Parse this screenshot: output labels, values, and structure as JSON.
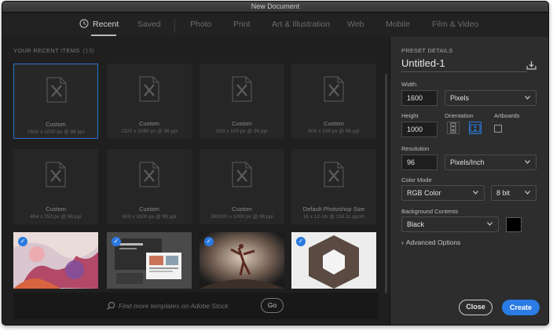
{
  "window": {
    "title": "New Document"
  },
  "tabs": [
    {
      "label": "Recent",
      "active": true
    },
    {
      "label": "Saved"
    },
    {
      "label": "Photo"
    },
    {
      "label": "Print"
    },
    {
      "label": "Art & Illustration"
    },
    {
      "label": "Web"
    },
    {
      "label": "Mobile"
    },
    {
      "label": "Film & Video"
    }
  ],
  "recent": {
    "heading": "YOUR RECENT ITEMS",
    "count": "(13)",
    "items": [
      {
        "name": "Custom",
        "spec": "1600 x 1000 px @ 96 ppi",
        "selected": true
      },
      {
        "name": "Custom",
        "spec": "1920 x 1080 px @ 96 ppi"
      },
      {
        "name": "Custom",
        "spec": "810 x 100 px @ 96 ppi"
      },
      {
        "name": "Custom",
        "spec": "600 x 336 px @ 96 ppi"
      },
      {
        "name": "Custom",
        "spec": "484 x 253 px @ 96 ppi"
      },
      {
        "name": "Custom",
        "spec": "600 x 1000 px @ 96 ppi"
      },
      {
        "name": "Custom",
        "spec": "300000 x 1000 px @ 96 ppi"
      },
      {
        "name": "Default Photoshop Size",
        "spec": "16 x 12 cm @ 118.11 ppcm"
      }
    ],
    "templates": [
      {
        "name": "template-paint-swatches"
      },
      {
        "name": "template-web-layout"
      },
      {
        "name": "template-dancer-photo"
      },
      {
        "name": "template-hexagon-frame"
      }
    ]
  },
  "stock": {
    "placeholder": "Find more templates on Adobe Stock",
    "go_label": "Go"
  },
  "preset": {
    "heading": "PRESET DETAILS",
    "name": "Untitled-1",
    "width_label": "Width",
    "width_value": "1600",
    "width_unit": "Pixels",
    "height_label": "Height",
    "height_value": "1000",
    "orientation_label": "Orientation",
    "artboards_label": "Artboards",
    "resolution_label": "Resolution",
    "resolution_value": "96",
    "resolution_unit": "Pixels/Inch",
    "color_mode_label": "Color Mode",
    "color_mode_value": "RGB Color",
    "bit_depth_value": "8 bit",
    "background_label": "Background Contents",
    "background_value": "Black",
    "background_swatch": "#000000",
    "advanced_label": "Advanced Options"
  },
  "actions": {
    "close_label": "Close",
    "create_label": "Create"
  },
  "colors": {
    "accent": "#2b7be4",
    "panel": "#2d2d2d",
    "background": "#1f1f1f"
  }
}
